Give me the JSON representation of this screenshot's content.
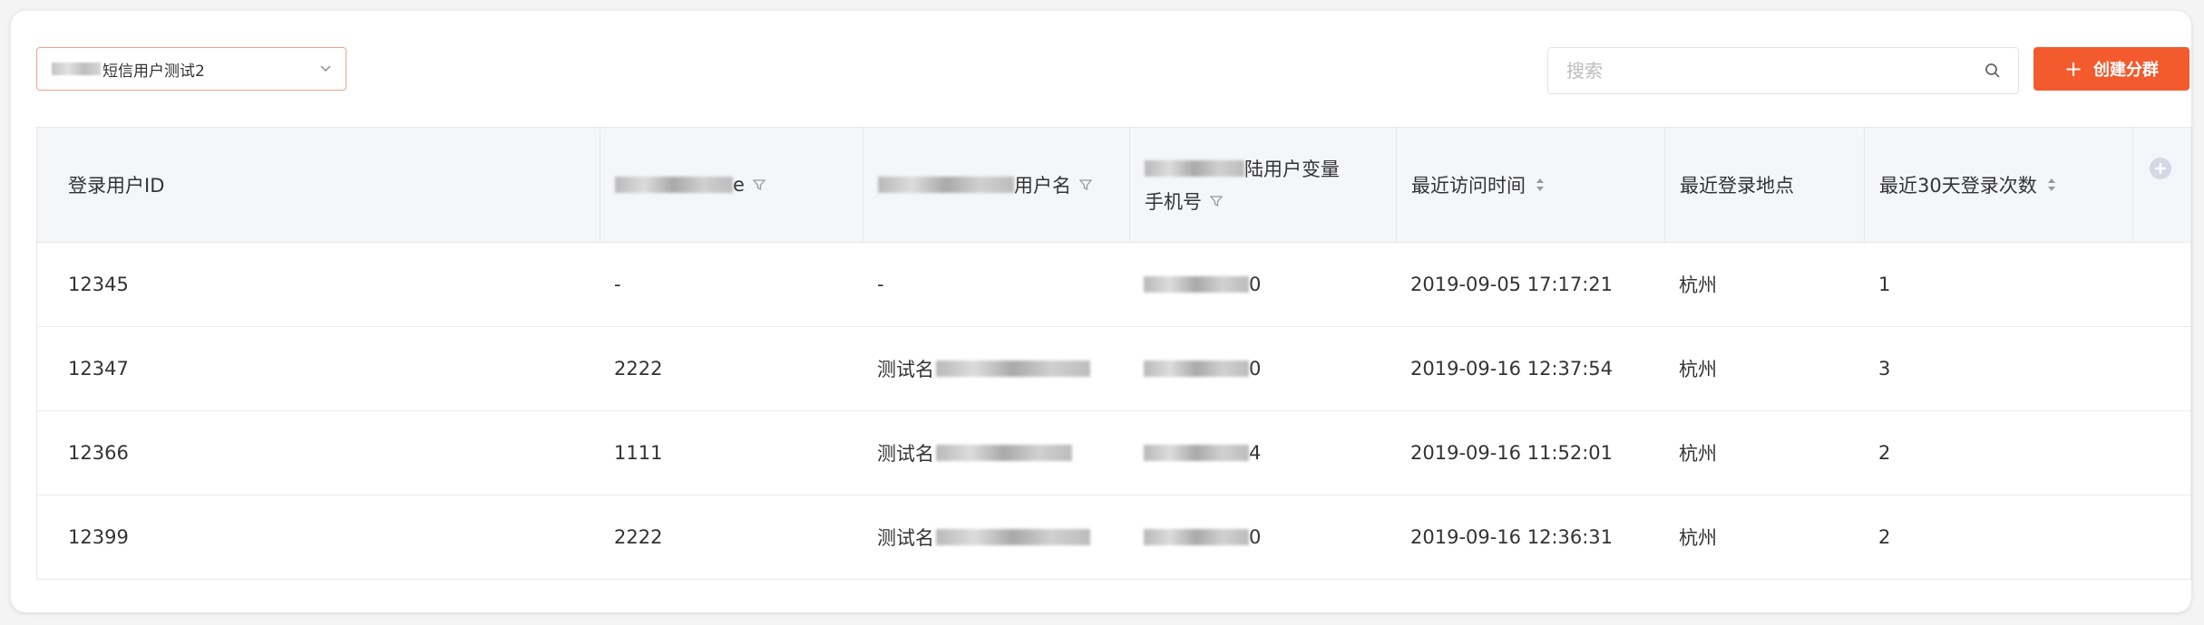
{
  "toolbar": {
    "segment_select_value": "短信用户测试2",
    "search_placeholder": "搜索",
    "create_button_label": "创建分群",
    "create_button_plus": "+"
  },
  "table": {
    "columns": [
      {
        "label": "登录用户ID",
        "filter": false,
        "sort": false
      },
      {
        "label": "e",
        "filter": true,
        "sort": false
      },
      {
        "label": "用户名",
        "filter": true,
        "sort": false
      },
      {
        "label": "陆用户变量",
        "label2": "手机号",
        "filter": true,
        "sort": false
      },
      {
        "label": "最近访问时间",
        "filter": false,
        "sort": true
      },
      {
        "label": "最近登录地点",
        "filter": false,
        "sort": false
      },
      {
        "label": "最近30天登录次数",
        "filter": false,
        "sort": true
      }
    ],
    "rows": [
      [
        "12345",
        "-",
        "-",
        "0",
        "2019-09-05 17:17:21",
        "杭州",
        "1"
      ],
      [
        "12347",
        "2222",
        "测试名",
        "0",
        "2019-09-16 12:37:54",
        "杭州",
        "3"
      ],
      [
        "12366",
        "1111",
        "测试名",
        "4",
        "2019-09-16 11:52:01",
        "杭州",
        "2"
      ],
      [
        "12399",
        "2222",
        "测试名",
        "0",
        "2019-09-16 12:36:31",
        "杭州",
        "2"
      ]
    ]
  },
  "colors": {
    "accent": "#f35a2d",
    "header_bg": "#f4f6fa",
    "select_border": "#f2a189"
  },
  "icons": {
    "select": "chevron-down-icon",
    "search": "search-icon",
    "filter": "filter-icon",
    "sort": "sort-icon",
    "add_column": "add-column-icon"
  }
}
